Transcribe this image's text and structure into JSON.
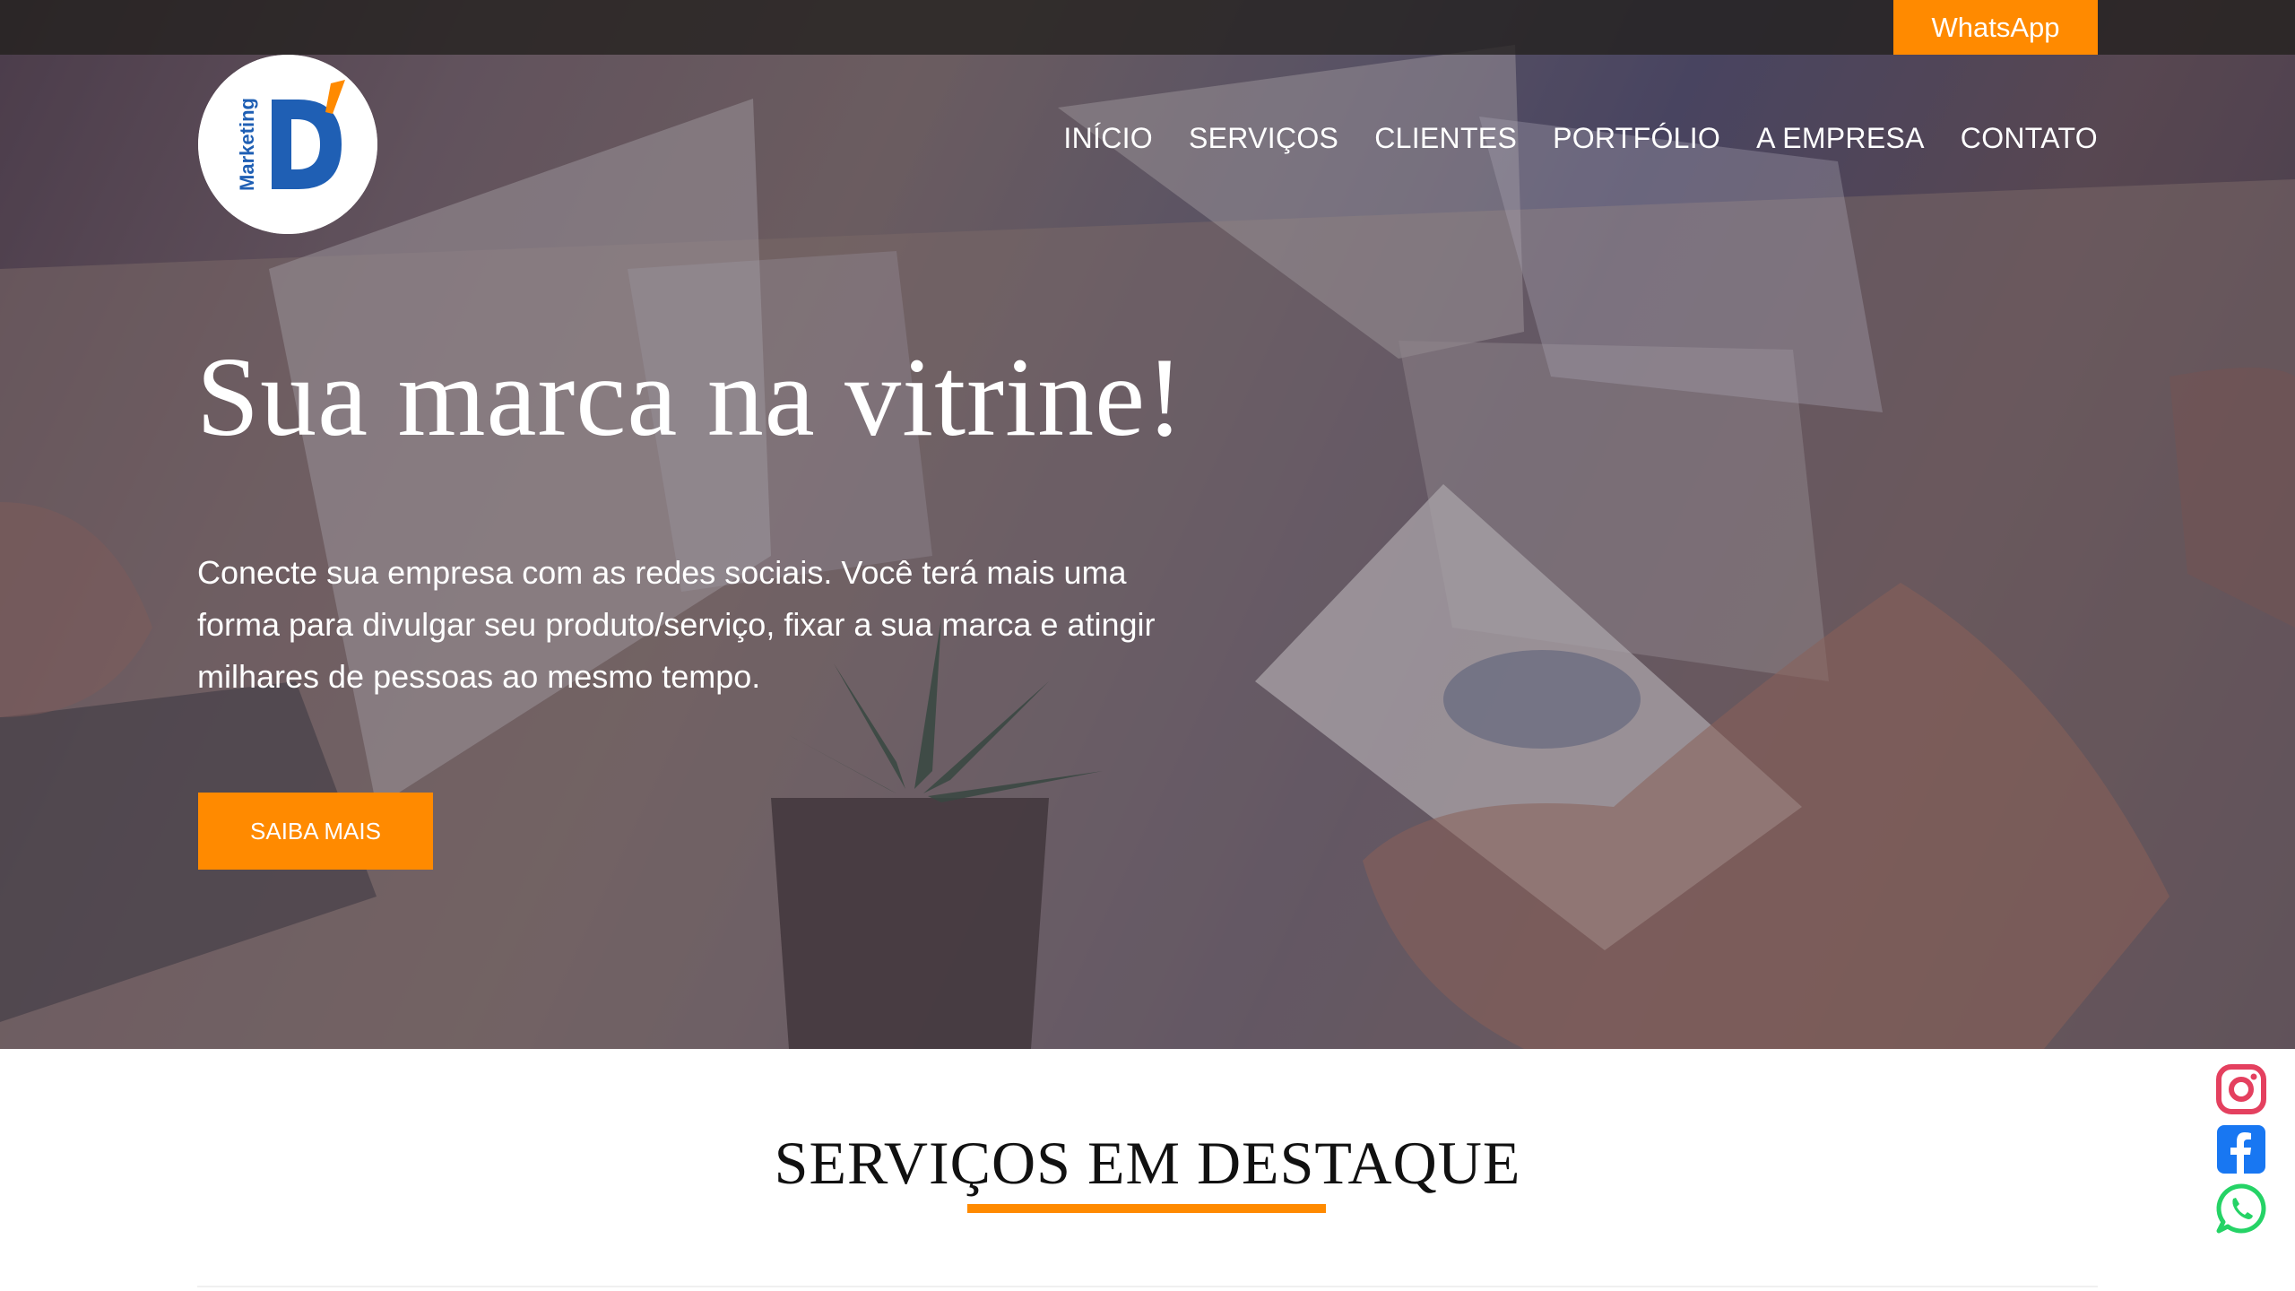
{
  "topbar": {
    "whatsapp_label": "WhatsApp"
  },
  "logo": {
    "text": "Marketing",
    "letter": "D"
  },
  "nav": {
    "items": [
      {
        "label": "INÍCIO"
      },
      {
        "label": "SERVIÇOS"
      },
      {
        "label": "CLIENTES"
      },
      {
        "label": "PORTFÓLIO"
      },
      {
        "label": "A EMPRESA"
      },
      {
        "label": "CONTATO"
      }
    ]
  },
  "hero": {
    "title": "Sua marca na vitrine!",
    "text": "Conecte sua empresa com as redes sociais. Você terá mais uma forma para divulgar seu produto/serviço, fixar a sua marca e atingir milhares de pessoas ao mesmo tempo.",
    "cta_label": "SAIBA MAIS"
  },
  "services": {
    "title": "SERVIÇOS EM DESTAQUE"
  },
  "social": {
    "icons": [
      "instagram-icon",
      "facebook-icon",
      "whatsapp-icon"
    ]
  },
  "colors": {
    "accent": "#ff8a00",
    "logo_blue": "#1f5fb4",
    "instagram": "#e4405f",
    "facebook": "#1877f2",
    "whatsapp": "#25d366"
  }
}
